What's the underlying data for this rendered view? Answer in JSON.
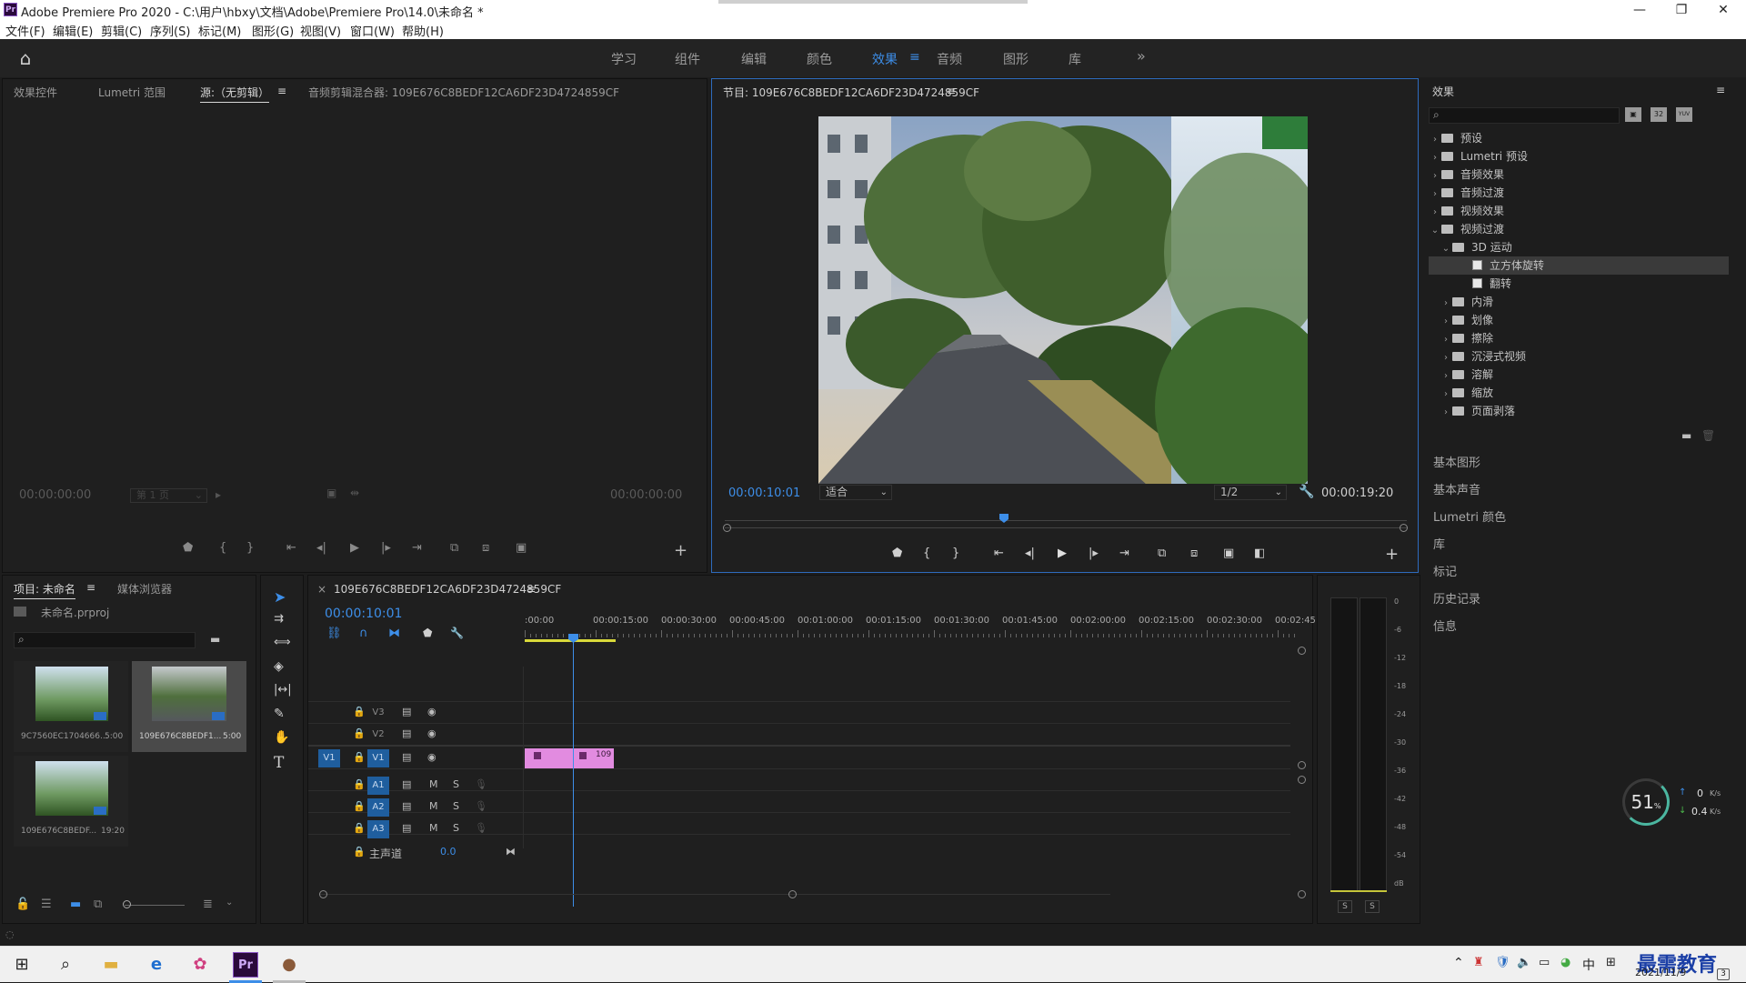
{
  "app": {
    "title": "Adobe Premiere Pro 2020 - C:\\用户\\hbxy\\文档\\Adobe\\Premiere Pro\\14.0\\未命名 *",
    "icon_label": "Pr",
    "window_controls": {
      "minimize": "—",
      "maximize": "❐",
      "close": "✕"
    }
  },
  "menu": [
    "文件(F)",
    "编辑(E)",
    "剪辑(C)",
    "序列(S)",
    "标记(M)",
    "图形(G)",
    "视图(V)",
    "窗口(W)",
    "帮助(H)"
  ],
  "workspaces": {
    "tabs": [
      "学习",
      "组件",
      "编辑",
      "颜色",
      "效果",
      "音频",
      "图形",
      "库"
    ],
    "active": "效果",
    "menu_glyph": "≡",
    "more_glyph": "»"
  },
  "source_panel": {
    "tabs": [
      "效果控件",
      "Lumetri 范围",
      "源:（无剪辑）",
      "音频剪辑混合器: 109E676C8BEDF12CA6DF23D4724859CF"
    ],
    "timecode_left": "00:00:00:00",
    "page_select": "第 1 页",
    "timecode_right": "00:00:00:00"
  },
  "program_panel": {
    "title": "节目: 109E676C8BEDF12CA6DF23D4724859CF",
    "timecode": "00:00:10:01",
    "fit": "适合",
    "resolution": "1/2",
    "duration": "00:00:19:20",
    "playhead_fraction": 0.5
  },
  "project_panel": {
    "tabs": [
      "项目: 未命名",
      "媒体浏览器"
    ],
    "project_file": "未命名.prproj",
    "items": [
      {
        "name": "9C7560EC1704666...",
        "duration": "5:00"
      },
      {
        "name": "109E676C8BEDF1...",
        "duration": "5:00"
      },
      {
        "name": "109E676C8BEDF...",
        "duration": "19:20"
      }
    ]
  },
  "timeline": {
    "sequence_tab": "109E676C8BEDF12CA6DF23D4724859CF",
    "close_glyph": "×",
    "timecode": "00:00:10:01",
    "ruler": [
      ":00:00",
      "00:00:15:00",
      "00:00:30:00",
      "00:00:45:00",
      "00:01:00:00",
      "00:01:15:00",
      "00:01:30:00",
      "00:01:45:00",
      "00:02:00:00",
      "00:02:15:00",
      "00:02:30:00",
      "00:02:45:"
    ],
    "tracks": {
      "video": [
        "V3",
        "V2",
        "V1"
      ],
      "audio": [
        "A1",
        "A2",
        "A3"
      ],
      "source_patch": "V1",
      "audio_buttons": {
        "mute": "M",
        "solo": "S"
      },
      "master_label": "主声道",
      "master_value": "0.0"
    },
    "clip_label": "109"
  },
  "audio_meter": {
    "scale": [
      "0",
      "-6",
      "-12",
      "-18",
      "-24",
      "-30",
      "-36",
      "-42",
      "-48",
      "-54",
      "dB"
    ],
    "solo_buttons": [
      "S",
      "S"
    ]
  },
  "effects_panel": {
    "title": "效果",
    "tree": [
      {
        "label": "预设",
        "level": 0,
        "expanded": false,
        "kind": "folder"
      },
      {
        "label": "Lumetri 预设",
        "level": 0,
        "expanded": false,
        "kind": "folder"
      },
      {
        "label": "音频效果",
        "level": 0,
        "expanded": false,
        "kind": "folder"
      },
      {
        "label": "音频过渡",
        "level": 0,
        "expanded": false,
        "kind": "folder"
      },
      {
        "label": "视频效果",
        "level": 0,
        "expanded": false,
        "kind": "folder"
      },
      {
        "label": "视频过渡",
        "level": 0,
        "expanded": true,
        "kind": "folder"
      },
      {
        "label": "3D 运动",
        "level": 1,
        "expanded": true,
        "kind": "folder"
      },
      {
        "label": "立方体旋转",
        "level": 2,
        "kind": "effect",
        "selected": true
      },
      {
        "label": "翻转",
        "level": 2,
        "kind": "effect"
      },
      {
        "label": "内滑",
        "level": 1,
        "expanded": false,
        "kind": "folder"
      },
      {
        "label": "划像",
        "level": 1,
        "expanded": false,
        "kind": "folder"
      },
      {
        "label": "擦除",
        "level": 1,
        "expanded": false,
        "kind": "folder"
      },
      {
        "label": "沉浸式视频",
        "level": 1,
        "expanded": false,
        "kind": "folder"
      },
      {
        "label": "溶解",
        "level": 1,
        "expanded": false,
        "kind": "folder"
      },
      {
        "label": "缩放",
        "level": 1,
        "expanded": false,
        "kind": "folder"
      },
      {
        "label": "页面剥落",
        "level": 1,
        "expanded": false,
        "kind": "folder"
      }
    ],
    "filter_buttons": [
      "32",
      "YUV"
    ]
  },
  "side_panels": [
    "基本图形",
    "基本声音",
    "Lumetri 颜色",
    "库",
    "标记",
    "历史记录",
    "信息"
  ],
  "net_widget": {
    "percent": "51",
    "percent_unit": "%",
    "upload": "0",
    "download": "0.4",
    "unit": "K/s"
  },
  "taskbar": {
    "date": "2021/11/9",
    "ime": "中",
    "watermark": "最需教育",
    "tray_badge": "3"
  },
  "colors": {
    "accent": "#3d8ee8",
    "clip": "#e28be0",
    "panel_bg": "#1f1f1f",
    "work_area": "#d9d93a"
  }
}
